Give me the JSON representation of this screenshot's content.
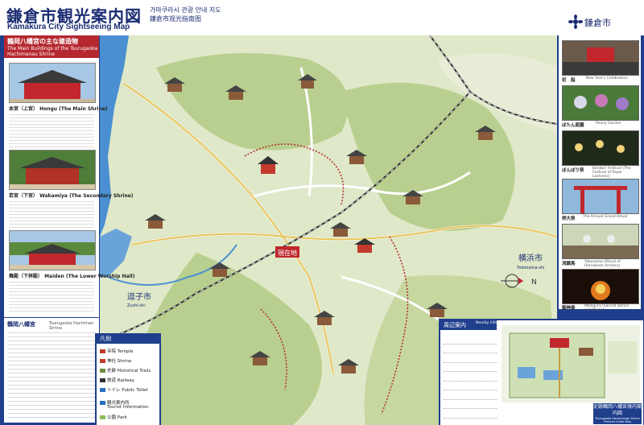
{
  "header": {
    "title_ja": "鎌倉市観光案内図",
    "title_en": "Kamakura City Sightseeing Map",
    "subtitle_lines": [
      "가마쿠라시 관광 안내 지도",
      "鎌倉市观光指南图"
    ],
    "city_name": "鎌倉市"
  },
  "left_panel": {
    "heading_ja": "鶴岡八幡宮の主な建造物",
    "heading_en": "The Main Buildings of the Tsurugaoka Hachimanau Shrine",
    "items": [
      {
        "caption": "本宮（上宮） Hongu (The Main Shrine)"
      },
      {
        "caption": "若宮（下宮） Wakamiya (The Secondary Shrine)"
      },
      {
        "caption": "舞殿（下拝殿） Maiden (The Lower Worship Hall)"
      }
    ]
  },
  "left_panel_2": {
    "heading_ja": "鶴岡八幡宮",
    "heading_en": "Tsurugaoka Hachiman Shrine"
  },
  "right_panel": {
    "items": [
      {
        "caption": "初　詣",
        "en": "New Year's Celebration"
      },
      {
        "caption": "ぼたん庭園",
        "en": "Peony Garden"
      },
      {
        "caption": "ぼんぼり祭",
        "en": "Bonbori Festival (The Festival of Paper Lanterns)"
      },
      {
        "caption": "例大祭",
        "en": "The Annual Grand Ritual"
      },
      {
        "caption": "流鏑馬",
        "en": "Yabusame (Ritual of Horseback Archery)"
      },
      {
        "caption": "御神楽",
        "en": "Mikagura (Sacred Dance and Music)"
      }
    ]
  },
  "map": {
    "labels": {
      "yokohama": "横浜市",
      "yokohama_en": "Yokohama-shi",
      "zushi": "逗子市",
      "zushi_en": "Zushi-shi",
      "current": "現在地",
      "north": "N"
    }
  },
  "legend": {
    "heading": "凡例",
    "rows": [
      {
        "ja": "寺院",
        "en": "Temple",
        "color": "#c33a2c"
      },
      {
        "ja": "神社",
        "en": "Shrine",
        "color": "#c33a2c"
      },
      {
        "ja": "史跡",
        "en": "Historical Trails",
        "color": "#6b8e3d"
      },
      {
        "ja": "鉄道",
        "en": "Railway",
        "color": "#333333"
      },
      {
        "ja": "トイレ",
        "en": "Public Toilet",
        "color": "#2a6fbf"
      },
      {
        "ja": "観光案内所",
        "en": "Tourist Information",
        "color": "#2a6fbf"
      },
      {
        "ja": "公園",
        "en": "Park",
        "color": "#8fbf5a"
      }
    ]
  },
  "inset": {
    "heading": "周辺案内",
    "heading_en": "Nearby information",
    "caption_ja": "史跡鶴岡八幡宮境内案内図",
    "caption_en": "Tsurugaoka Hachimangu Shrine Precinct Guide Map"
  },
  "colors": {
    "frame": "#1f3f8c",
    "accent_red": "#b5282f",
    "map_land": "#dfe8c8",
    "map_hill": "#b9cf8f",
    "sea": "#4a8fd1"
  }
}
